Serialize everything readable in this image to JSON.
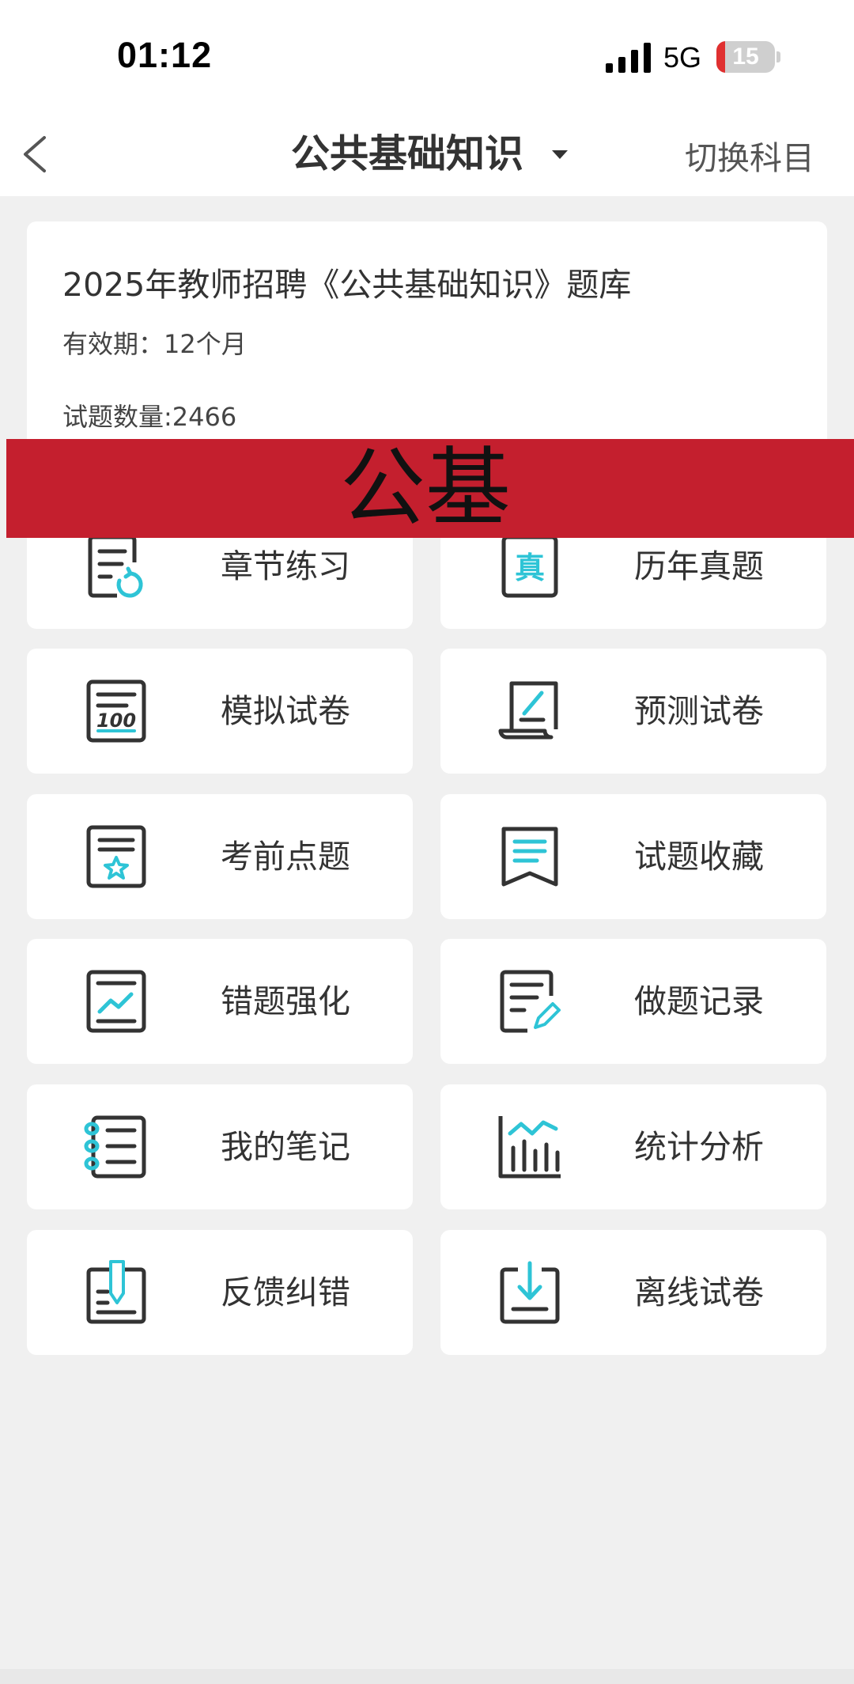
{
  "status_bar": {
    "time": "01:12",
    "network": "5G",
    "battery": 15
  },
  "nav": {
    "title": "公共基础知识",
    "switch_label": "切换科目"
  },
  "info_card": {
    "title": "2025年教师招聘《公共基础知识》题库",
    "validity": "有效期：12个月",
    "question_count": "试题数量:2466"
  },
  "banner": {
    "text": "公基"
  },
  "colors": {
    "accent": "#2ec4d6",
    "icon_stroke": "#333333",
    "banner_red": "#c41f2e",
    "background": "#f0f0f0"
  },
  "features": [
    {
      "label": "章节练习",
      "icon": "chapter-practice-icon"
    },
    {
      "label": "历年真题",
      "icon": "past-exam-icon"
    },
    {
      "label": "模拟试卷",
      "icon": "mock-exam-icon"
    },
    {
      "label": "预测试卷",
      "icon": "prediction-exam-icon"
    },
    {
      "label": "考前点题",
      "icon": "key-points-icon"
    },
    {
      "label": "试题收藏",
      "icon": "bookmark-icon"
    },
    {
      "label": "错题强化",
      "icon": "wrong-answers-icon"
    },
    {
      "label": "做题记录",
      "icon": "history-record-icon"
    },
    {
      "label": "我的笔记",
      "icon": "notebook-icon"
    },
    {
      "label": "统计分析",
      "icon": "statistics-icon"
    },
    {
      "label": "反馈纠错",
      "icon": "feedback-icon"
    },
    {
      "label": "离线试卷",
      "icon": "download-icon"
    }
  ]
}
